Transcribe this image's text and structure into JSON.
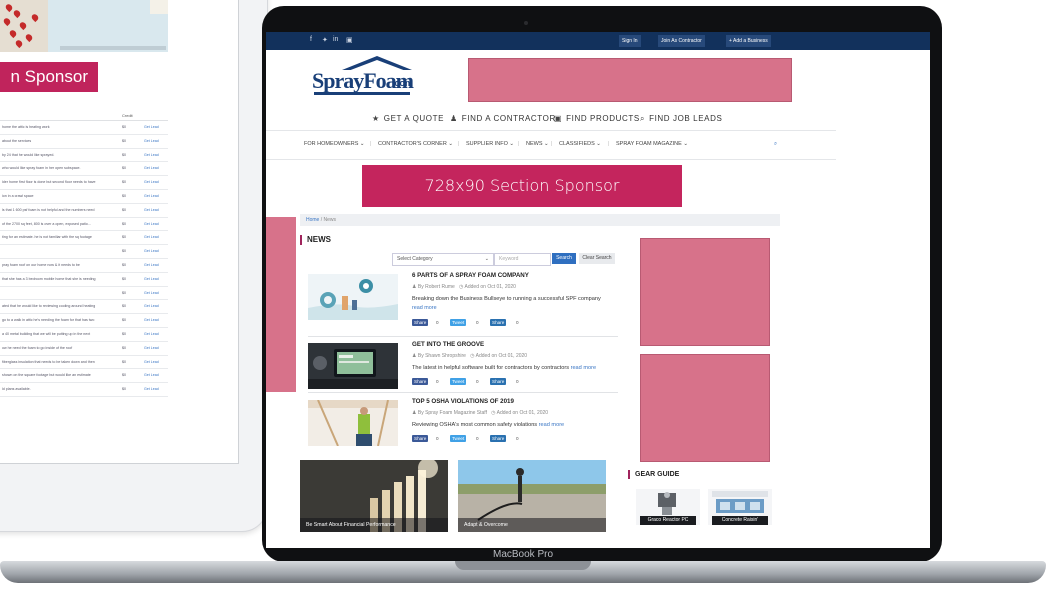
{
  "tablet": {
    "sponsor_label": "n Sponsor",
    "table": {
      "col_credit": "Credit",
      "rows": [
        {
          "text": "home the attic is heating work",
          "credit": "$0",
          "action": "Get Lead"
        },
        {
          "text": "about the services",
          "credit": "$0",
          "action": "Get Lead"
        },
        {
          "text": "by 24 that he would like sprayed.",
          "credit": "$0",
          "action": "Get Lead"
        },
        {
          "text": "who would like spray foam in her open subspace.",
          "credit": "$0",
          "action": "Get Lead"
        },
        {
          "text": "lder home first floor is done but second floor needs to have",
          "credit": "$0",
          "action": "Get Lead"
        },
        {
          "text": "ion in a crawl space",
          "credit": "$0",
          "action": "Get Lead"
        },
        {
          "text": "ls that 1 600 psf foam is not helpful and the numbers need",
          "credit": "$0",
          "action": "Get Lead"
        },
        {
          "text": "of the 2700 sq feet, 800 is over a open, exposed patio...",
          "credit": "$0",
          "action": "Get Lead"
        },
        {
          "text": "ting for an estimate. he is not familiar with the sq footage",
          "credit": "$0",
          "action": "Get Lead"
        },
        {
          "text": "",
          "credit": "$0",
          "action": "Get Lead"
        },
        {
          "text": "pray foam roof on our home now & it needs to be",
          "credit": "$0",
          "action": "Get Lead"
        },
        {
          "text": "that she has a 3 bedroom mobile home that she is needing",
          "credit": "$0",
          "action": "Get Lead"
        },
        {
          "text": "",
          "credit": "$0",
          "action": "Get Lead"
        },
        {
          "text": "ated that he would like to reviewing cooling around heating",
          "credit": "$0",
          "action": "Get Lead"
        },
        {
          "text": "go to a walk in attic he's needing the foam for that has two",
          "credit": "$0",
          "action": "Get Lead"
        },
        {
          "text": "a 40 metal building that we will be putting up in the next",
          "credit": "$0",
          "action": "Get Lead"
        },
        {
          "text": "ow he need the foam to go inside of the roof",
          "credit": "$0",
          "action": "Get Lead"
        },
        {
          "text": "fiberglass insulation that needs to be taken down and then",
          "credit": "$0",
          "action": "Get Lead"
        },
        {
          "text": "shown on the square footage but would like an estimate",
          "credit": "$0",
          "action": "Get Lead"
        },
        {
          "text": "ld plans available.",
          "credit": "$0",
          "action": "Get Lead"
        }
      ]
    }
  },
  "laptop": {
    "brand": "MacBook Pro"
  },
  "site": {
    "topbar": {
      "social": [
        "f",
        "✦",
        "in",
        "▣"
      ],
      "sign_in": "Sign In",
      "join": "Join As Contractor",
      "add_business": "+ Add a Business"
    },
    "logo": {
      "word": "SprayFoam",
      "com": ".com"
    },
    "main_nav": [
      "GET A QUOTE",
      "FIND A CONTRACTOR",
      "FIND PRODUCTS",
      "FIND JOB LEADS"
    ],
    "sub_nav": [
      "FOR HOMEOWNERS",
      "CONTRACTOR'S CORNER",
      "SUPPLIER INFO",
      "NEWS",
      "CLASSIFIEDS",
      "SPRAY FOAM MAGAZINE"
    ],
    "section_sponsor": "728x90 Section Sponsor",
    "breadcrumb": {
      "home": "Home",
      "current": "News"
    },
    "news_heading": "NEWS",
    "filter": {
      "category": "Select Category",
      "keyword_placeholder": "Keyword",
      "search": "Search",
      "clear": "Clear Search"
    },
    "articles": [
      {
        "title": "6 PARTS OF A SPRAY FOAM COMPANY",
        "author": "By Robert Rume",
        "date": "Added on Oct 01, 2020",
        "excerpt": "Breaking down the Business Bullseye to running a successful SPF company",
        "read_more": "read more",
        "shares": {
          "fb": "Share",
          "fb_count": "0",
          "tw": "Tweet",
          "tw_count": "0",
          "li": "Share",
          "li_count": "0"
        }
      },
      {
        "title": "GET INTO THE GROOVE",
        "author": "By Shawn Shropshire",
        "date": "Added on Oct 01, 2020",
        "excerpt": "The latest in helpful software built for contractors by contractors",
        "read_more": "read more",
        "shares": {
          "fb": "Share",
          "fb_count": "0",
          "tw": "Tweet",
          "tw_count": "0",
          "li": "Share",
          "li_count": "0"
        }
      },
      {
        "title": "TOP 5 OSHA VIOLATIONS OF 2019",
        "author": "By Spray Foam Magazine Staff",
        "date": "Added on Oct 01, 2020",
        "excerpt": "Reviewing OSHA's most common safety violations",
        "read_more": "read more",
        "shares": {
          "fb": "Share",
          "fb_count": "0",
          "tw": "Tweet",
          "tw_count": "0",
          "li": "Share",
          "li_count": "0"
        }
      }
    ],
    "cards": [
      "Be Smart About Financial Performance",
      "Adapt & Overcome"
    ],
    "gear_guide": {
      "heading": "GEAR GUIDE",
      "items": [
        "Graco Reactor PC",
        "Concrete Raisin'"
      ]
    },
    "colors": {
      "navy": "#12315c",
      "accent": "#c4255d",
      "ad_placeholder": "#d7728a",
      "link": "#3a76c4"
    }
  }
}
